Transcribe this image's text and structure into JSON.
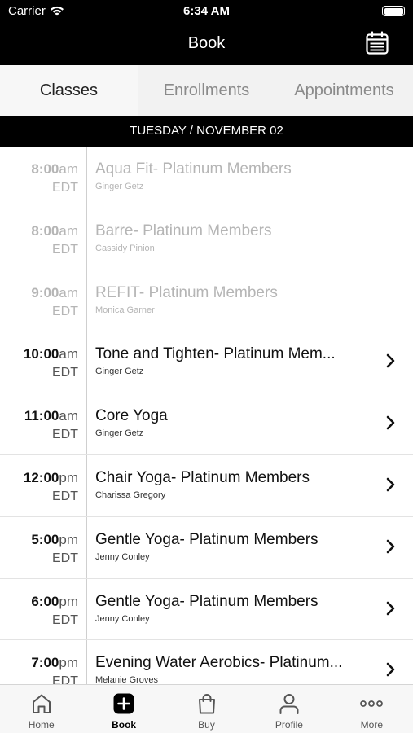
{
  "status_bar": {
    "carrier": "Carrier",
    "time": "6:34 AM"
  },
  "header": {
    "title": "Book",
    "calendar_icon": "calendar-icon"
  },
  "tabs": [
    {
      "label": "Classes",
      "active": true
    },
    {
      "label": "Enrollments",
      "active": false
    },
    {
      "label": "Appointments",
      "active": false
    }
  ],
  "date_label": "TUESDAY / NOVEMBER 02",
  "classes": [
    {
      "time": "8:00",
      "ampm": "am",
      "tz": "EDT",
      "name": "Aqua Fit- Platinum Members",
      "instructor": "Ginger Getz",
      "past": true
    },
    {
      "time": "8:00",
      "ampm": "am",
      "tz": "EDT",
      "name": "Barre- Platinum Members",
      "instructor": "Cassidy Pinion",
      "past": true
    },
    {
      "time": "9:00",
      "ampm": "am",
      "tz": "EDT",
      "name": "REFIT- Platinum Members",
      "instructor": "Monica Garner",
      "past": true
    },
    {
      "time": "10:00",
      "ampm": "am",
      "tz": "EDT",
      "name": "Tone and Tighten- Platinum Mem...",
      "instructor": "Ginger Getz",
      "past": false
    },
    {
      "time": "11:00",
      "ampm": "am",
      "tz": "EDT",
      "name": "Core Yoga",
      "instructor": "Ginger Getz",
      "past": false
    },
    {
      "time": "12:00",
      "ampm": "pm",
      "tz": "EDT",
      "name": "Chair Yoga- Platinum Members",
      "instructor": "Charissa Gregory",
      "past": false
    },
    {
      "time": "5:00",
      "ampm": "pm",
      "tz": "EDT",
      "name": "Gentle Yoga- Platinum Members",
      "instructor": "Jenny Conley",
      "past": false
    },
    {
      "time": "6:00",
      "ampm": "pm",
      "tz": "EDT",
      "name": "Gentle Yoga- Platinum Members",
      "instructor": "Jenny Conley",
      "past": false
    },
    {
      "time": "7:00",
      "ampm": "pm",
      "tz": "EDT",
      "name": "Evening Water Aerobics- Platinum...",
      "instructor": "Melanie Groves",
      "past": false
    }
  ],
  "tab_bar": [
    {
      "label": "Home",
      "icon": "home-icon",
      "active": false
    },
    {
      "label": "Book",
      "icon": "plus-square-icon",
      "active": true
    },
    {
      "label": "Buy",
      "icon": "shopping-bag-icon",
      "active": false
    },
    {
      "label": "Profile",
      "icon": "profile-icon",
      "active": false
    },
    {
      "label": "More",
      "icon": "more-icon",
      "active": false
    }
  ],
  "colors": {
    "header_bg": "#000000",
    "tab_bg": "#f2f2f2",
    "past_text": "#b5b5b5",
    "divider": "#e3e3e3"
  }
}
